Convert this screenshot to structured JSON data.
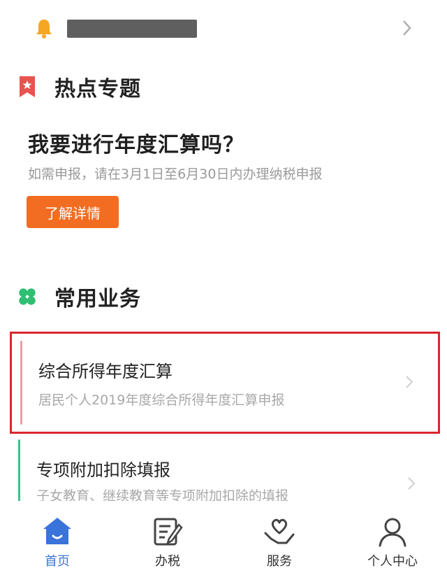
{
  "notice": {
    "text": "",
    "icon": "bell-icon",
    "arrow_icon": "chevron-right-icon"
  },
  "hot_section": {
    "title": "热点专题",
    "icon": "bookmark-star-icon"
  },
  "hot_card": {
    "title": "我要进行年度汇算吗？",
    "subtitle": "如需申报，请在3月1日至6月30日内办理纳税申报",
    "button_label": "了解详情"
  },
  "common_section": {
    "title": "常用业务",
    "icon": "clover-icon"
  },
  "services": [
    {
      "title": "综合所得年度汇算",
      "subtitle": "居民个人2019年度综合所得年度汇算申报",
      "accent": "#e8a0a8"
    },
    {
      "title": "专项附加扣除填报",
      "subtitle": "子女教育、继续教育等专项附加扣除的填报",
      "accent": "#3cc28a"
    }
  ],
  "tabbar": {
    "items": [
      {
        "label": "首页",
        "icon": "home-icon",
        "active": true
      },
      {
        "label": "办税",
        "icon": "document-edit-icon",
        "active": false
      },
      {
        "label": "服务",
        "icon": "heart-hand-icon",
        "active": false
      },
      {
        "label": "个人中心",
        "icon": "person-icon",
        "active": false
      }
    ]
  },
  "colors": {
    "accent_orange": "#f26d22",
    "selection_red": "#d9262c",
    "tab_active": "#3a73d9",
    "clover_green": "#2fbf73"
  }
}
